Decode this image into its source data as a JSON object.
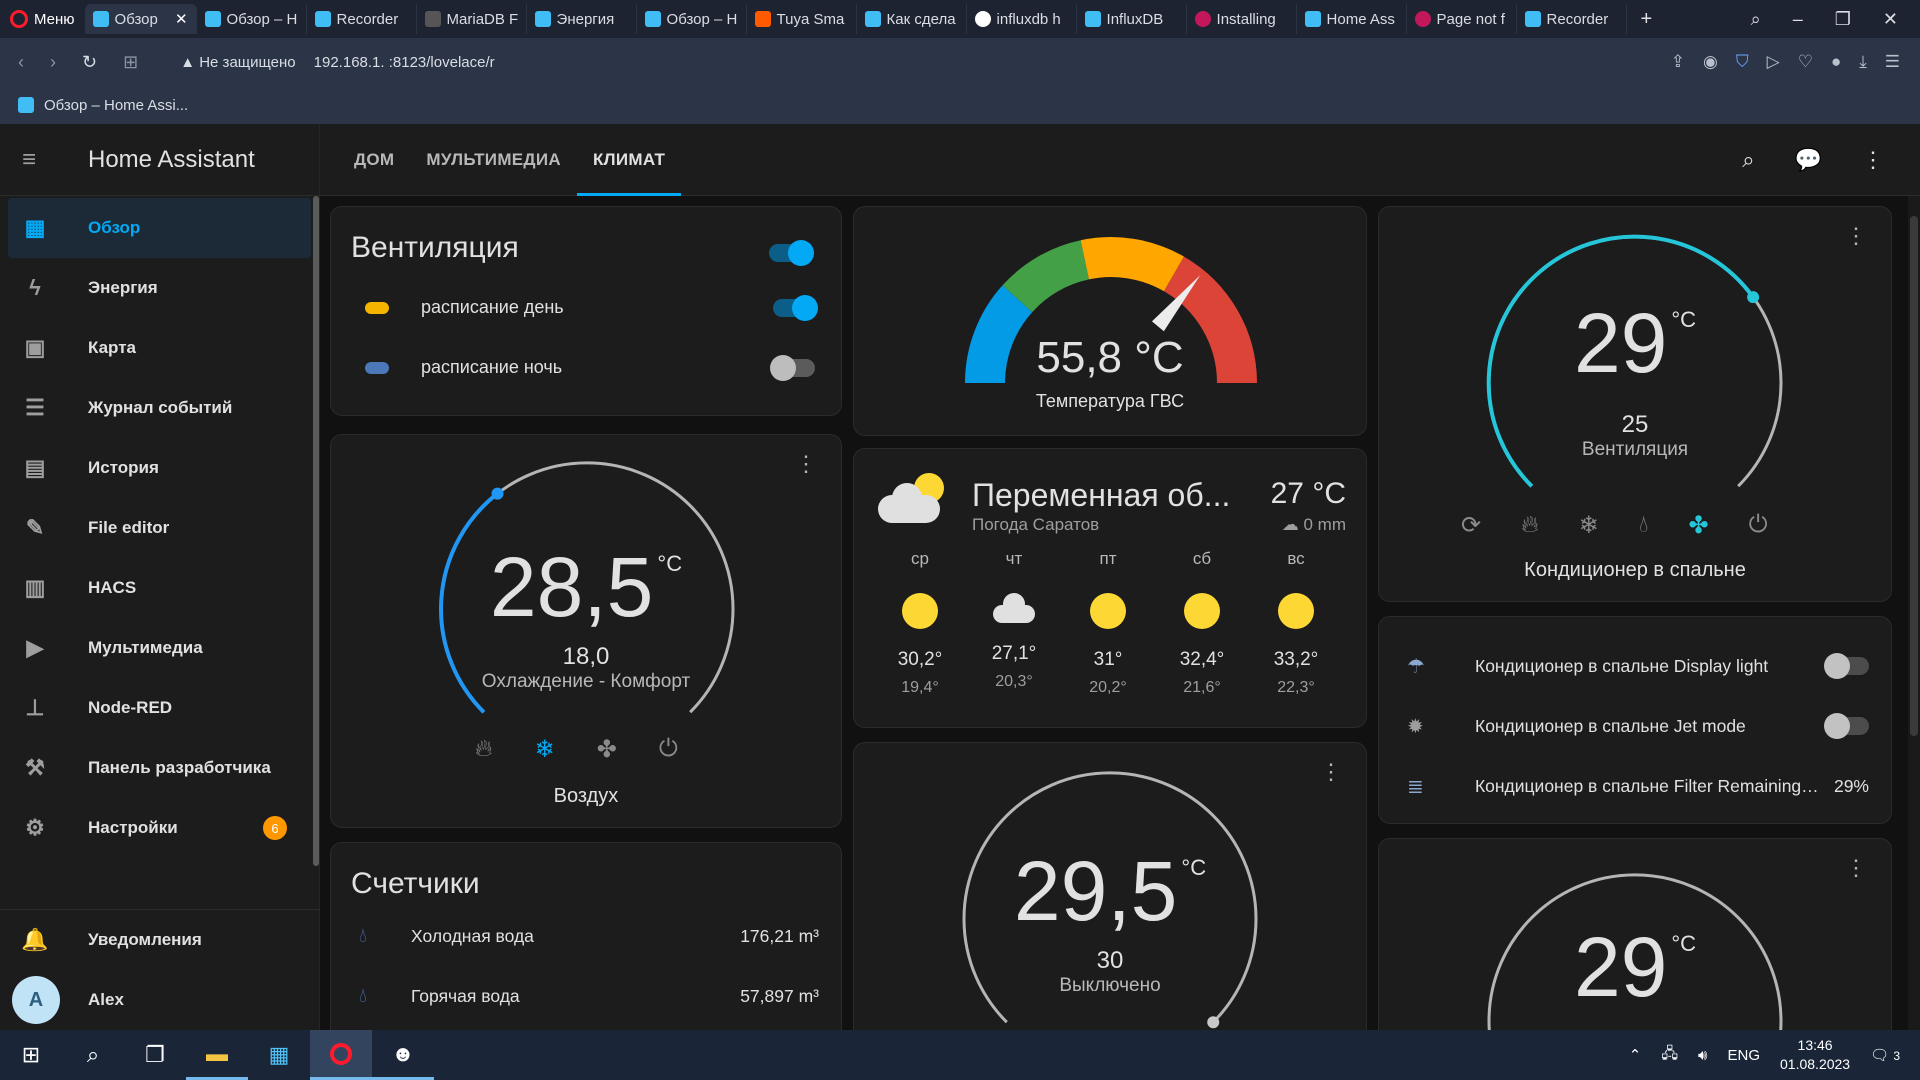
{
  "browser": {
    "menu_label": "Меню",
    "tabs": [
      "Обзор",
      "Обзор – Н",
      "Recorder",
      "MariaDB F",
      "Энергия",
      "Обзор – Н",
      "Tuya Sma",
      "Как сдела",
      "influxdb h",
      "InfluxDB",
      "Installing",
      "Home Ass",
      "Page not f",
      "Recorder"
    ],
    "warning": "Не защищено",
    "url": "192.168.1.   :8123/lovelace/r",
    "bookmark": "Обзор – Home Assi..."
  },
  "sidebar": {
    "title": "Home Assistant",
    "items": [
      {
        "label": "Обзор",
        "icon": "dashboard-icon"
      },
      {
        "label": "Энергия",
        "icon": "lightning-icon"
      },
      {
        "label": "Карта",
        "icon": "map-icon"
      },
      {
        "label": "Журнал событий",
        "icon": "logbook-icon"
      },
      {
        "label": "История",
        "icon": "history-icon"
      },
      {
        "label": "File editor",
        "icon": "wrench-icon"
      },
      {
        "label": "HACS",
        "icon": "hacs-icon"
      },
      {
        "label": "Мультимедиа",
        "icon": "media-icon"
      },
      {
        "label": "Node-RED",
        "icon": "sitemap-icon"
      },
      {
        "label": "Панель разработчика",
        "icon": "hammer-icon"
      },
      {
        "label": "Настройки",
        "icon": "gear-icon"
      }
    ],
    "settings_badge": "6",
    "notifications": "Уведомления",
    "user_initial": "A",
    "user_name": "Alex"
  },
  "views": {
    "tabs": [
      "ДОМ",
      "МУЛЬТИМЕДИА",
      "КЛИМАТ"
    ],
    "active": "КЛИМАТ"
  },
  "ventilation": {
    "title": "Вентиляция",
    "main_on": true,
    "rows": [
      {
        "label": "расписание день",
        "on": true
      },
      {
        "label": "расписание ночь",
        "on": false
      }
    ]
  },
  "thermo_air": {
    "current": "28,5",
    "unit": "°C",
    "target": "18,0",
    "action": "Охлаждение - Комфорт",
    "name": "Воздух",
    "setpoint_fraction": 0.36
  },
  "counters": {
    "title": "Счетчики",
    "rows": [
      {
        "label": "Холодная вода",
        "value": "176,21 m³"
      },
      {
        "label": "Горячая вода",
        "value": "57,897 m³"
      }
    ]
  },
  "gauge": {
    "value": "55,8 °C",
    "name": "Температура ГВС",
    "fraction": 0.72,
    "colors": [
      "#039be5",
      "#43a047",
      "#ffa600",
      "#db4437"
    ]
  },
  "weather": {
    "condition": "Переменная об...",
    "temp": "27 °C",
    "location": "Погода Саратов",
    "precip": "0 mm",
    "forecast": [
      {
        "day": "ср",
        "icon": "sun",
        "hi": "30,2°",
        "lo": "19,4°"
      },
      {
        "day": "чт",
        "icon": "cloud",
        "hi": "27,1°",
        "lo": "20,3°"
      },
      {
        "day": "пт",
        "icon": "sun",
        "hi": "31°",
        "lo": "20,2°"
      },
      {
        "day": "сб",
        "icon": "sun",
        "hi": "32,4°",
        "lo": "21,6°"
      },
      {
        "day": "вс",
        "icon": "sun",
        "hi": "33,2°",
        "lo": "22,3°"
      }
    ]
  },
  "thermo_off": {
    "current": "29,5",
    "unit": "°C",
    "target": "30",
    "action": "Выключено"
  },
  "ac_bedroom": {
    "current": "29",
    "unit": "°C",
    "target": "25",
    "action": "Вентиляция",
    "name": "Кондиционер в спальне",
    "setpoint_fraction": 0.7
  },
  "ac_entities": [
    {
      "label": "Кондиционер в спальне Display light",
      "type": "switch",
      "icon": "lamp-icon"
    },
    {
      "label": "Кондиционер в спальне Jet mode",
      "type": "switch",
      "icon": "jet-icon"
    },
    {
      "label": "Кондиционер в спальне Filter Remaining ...",
      "value": "29%",
      "icon": "filter-icon"
    }
  ],
  "thermo_bottom": {
    "current": "29",
    "unit": "°C"
  },
  "taskbar": {
    "lang": "ENG",
    "time": "13:46",
    "date": "01.08.2023",
    "notif_count": "3"
  }
}
